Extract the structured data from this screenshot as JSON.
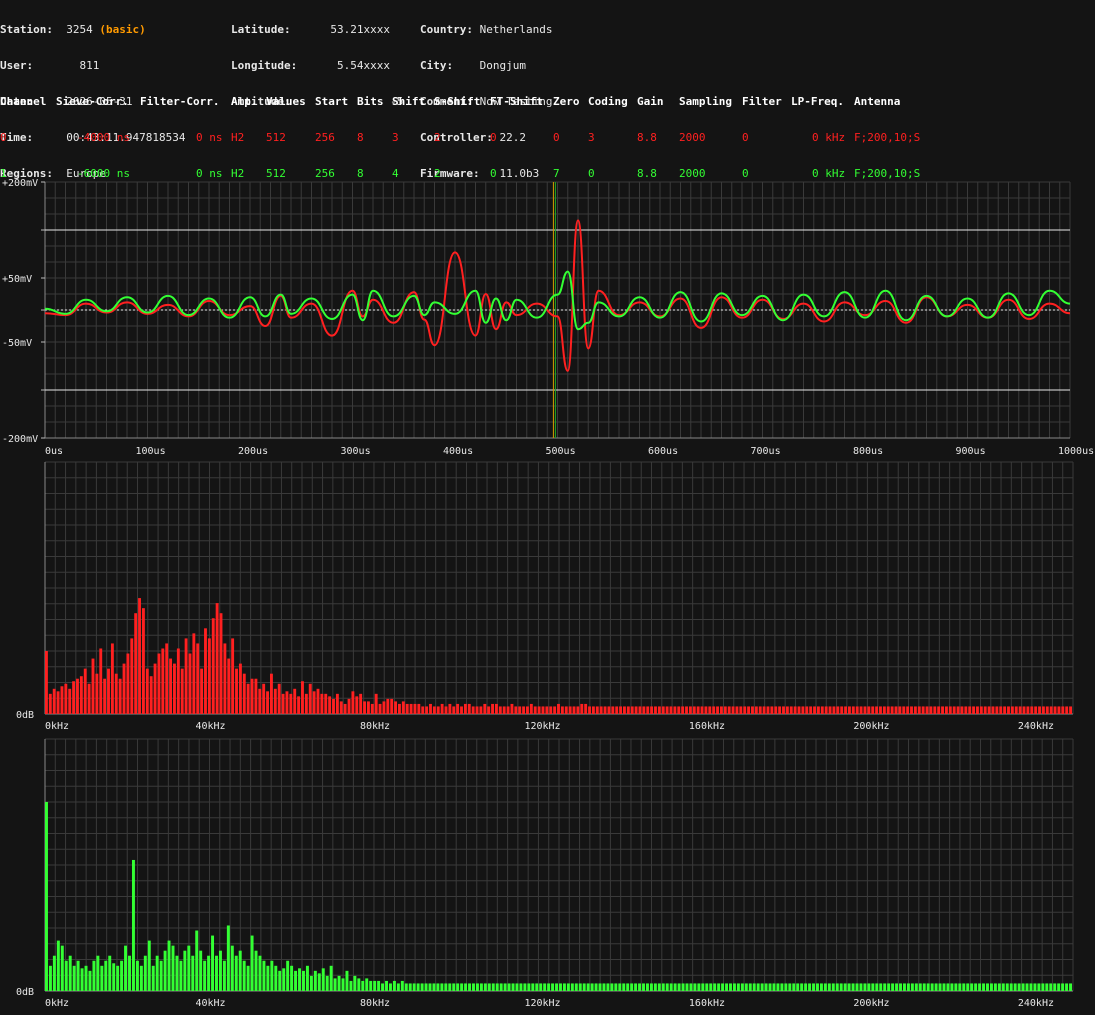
{
  "header": {
    "station_label": "Station:",
    "station_value": "3254",
    "station_tag": "(basic)",
    "user_label": "User:",
    "user_value": "811",
    "date_label": "Date:",
    "date_value": "2026-05-31",
    "time_label": "Time:",
    "time_value": "00:43:11.947818534",
    "regions_label": "Regions:",
    "regions_value": "Europe",
    "latitude_label": "Latitude:",
    "latitude_value": "53.21xxxx",
    "longitude_label": "Longitude:",
    "longitude_value": "5.54xxxx",
    "altitude_label": "Altitude:",
    "altitude_value": "-5",
    "country_label": "Country:",
    "country_value": "Netherlands",
    "city_label": "City:",
    "city_value": "Dongjum",
    "comment_label": "Comment:",
    "comment_value": "Now Testing",
    "controller_label": "Controller:",
    "controller_value": "22.2",
    "firmware_label": "Firmware:",
    "firmware_value": "11.0b3"
  },
  "channels": {
    "headers": [
      "Channel",
      "Sieve-Corr.",
      "Filter-Corr.",
      "Amp.",
      "Values",
      "Start",
      "Bits",
      "Shift",
      "S-Shift",
      "FT-Shift",
      "Zero",
      "Coding",
      "Gain",
      "Sampling",
      "Filter",
      "LP-Freq.",
      "Antenna"
    ],
    "rows": [
      {
        "color": "#ff2020",
        "cells": [
          "0",
          "-4000 ns",
          "0 ns",
          "H2",
          "512",
          "256",
          "8",
          "3",
          "2",
          "0",
          "0",
          "3",
          "8.8",
          "2000",
          "0",
          "0 kHz",
          "F;200,10;S"
        ]
      },
      {
        "color": "#33ff33",
        "cells": [
          "1",
          "-6000 ns",
          "0 ns",
          "H2",
          "512",
          "256",
          "8",
          "4",
          "2",
          "0",
          "7",
          "0",
          "8.8",
          "2000",
          "0",
          "0 kHz",
          "F;200,10;S"
        ]
      }
    ]
  },
  "colors": {
    "ch0": "#ff2020",
    "ch1": "#33ff33",
    "grid": "#3a3a3a",
    "background": "#141414",
    "trigger": "#ff9a00"
  },
  "chart_data": [
    {
      "type": "line",
      "y_unit": "mV",
      "x_unit": "us",
      "xlim": [
        0,
        1000
      ],
      "ylim": [
        -200,
        200
      ],
      "y_tick_labels": [
        "+200mV",
        "+50mV",
        "-50mV",
        "-200mV"
      ],
      "y_tick_values": [
        200,
        50,
        -50,
        -200
      ],
      "x_tick_labels": [
        "0us",
        "100us",
        "200us",
        "300us",
        "400us",
        "500us",
        "600us",
        "700us",
        "800us",
        "900us",
        "1000us"
      ],
      "reference_lines_mV": [
        125,
        -125,
        0
      ],
      "trigger_us": 496,
      "series": [
        {
          "color": "#ff2020",
          "x": [
            0,
            20,
            40,
            60,
            80,
            100,
            120,
            140,
            160,
            180,
            200,
            215,
            230,
            240,
            260,
            280,
            300,
            310,
            320,
            340,
            360,
            370,
            380,
            400,
            420,
            430,
            440,
            450,
            460,
            480,
            500,
            510,
            520,
            530,
            540,
            560,
            580,
            600,
            620,
            640,
            660,
            680,
            700,
            720,
            740,
            760,
            780,
            800,
            820,
            840,
            860,
            880,
            900,
            920,
            940,
            960,
            980,
            1000
          ],
          "y": [
            -5,
            -8,
            10,
            -4,
            12,
            -6,
            8,
            -10,
            14,
            -8,
            6,
            -25,
            22,
            -12,
            10,
            -40,
            30,
            -10,
            16,
            -20,
            28,
            -15,
            -55,
            90,
            -40,
            25,
            -30,
            12,
            -8,
            10,
            -10,
            -95,
            140,
            -60,
            30,
            -8,
            12,
            -10,
            18,
            -28,
            20,
            -12,
            16,
            -14,
            10,
            -18,
            12,
            -8,
            14,
            -20,
            20,
            -10,
            8,
            -12,
            16,
            -14,
            10,
            -5
          ]
        },
        {
          "color": "#33ff33",
          "x": [
            0,
            20,
            40,
            60,
            80,
            100,
            120,
            140,
            160,
            180,
            200,
            215,
            230,
            240,
            260,
            280,
            300,
            310,
            320,
            340,
            360,
            370,
            380,
            400,
            420,
            430,
            440,
            450,
            460,
            480,
            500,
            510,
            520,
            530,
            540,
            560,
            580,
            600,
            620,
            640,
            660,
            680,
            700,
            720,
            740,
            760,
            780,
            800,
            820,
            840,
            860,
            880,
            900,
            920,
            940,
            960,
            980,
            1000
          ],
          "y": [
            2,
            -6,
            16,
            -2,
            20,
            -4,
            22,
            -8,
            18,
            -12,
            20,
            -10,
            24,
            -6,
            18,
            -14,
            24,
            -16,
            30,
            -10,
            22,
            -8,
            12,
            -6,
            30,
            -20,
            18,
            -16,
            16,
            -12,
            24,
            60,
            -30,
            -20,
            12,
            -10,
            20,
            -12,
            28,
            -18,
            26,
            -8,
            22,
            -16,
            24,
            -10,
            28,
            -12,
            30,
            -16,
            22,
            -10,
            18,
            -12,
            26,
            -8,
            30,
            10
          ]
        }
      ]
    },
    {
      "type": "bar",
      "y_unit": "dB",
      "x_unit": "kHz",
      "xlim": [
        0,
        250
      ],
      "y_tick_labels": [
        "0dB"
      ],
      "x_tick_labels": [
        "0kHz",
        "40kHz",
        "80kHz",
        "120kHz",
        "160kHz",
        "200kHz",
        "240kHz"
      ],
      "series": [
        {
          "color": "#ff2020",
          "values": [
            25,
            8,
            10,
            9,
            11,
            12,
            10,
            13,
            14,
            15,
            18,
            12,
            22,
            16,
            26,
            14,
            18,
            28,
            16,
            14,
            20,
            24,
            30,
            40,
            46,
            42,
            18,
            15,
            20,
            24,
            26,
            28,
            22,
            20,
            26,
            18,
            30,
            24,
            32,
            28,
            18,
            34,
            30,
            38,
            44,
            40,
            28,
            22,
            30,
            18,
            20,
            16,
            12,
            14,
            14,
            10,
            12,
            9,
            16,
            10,
            12,
            8,
            9,
            8,
            10,
            7,
            13,
            8,
            12,
            9,
            10,
            8,
            8,
            7,
            6,
            8,
            5,
            4,
            6,
            9,
            7,
            8,
            5,
            5,
            4,
            8,
            4,
            5,
            6,
            6,
            5,
            4,
            5,
            4,
            4,
            4,
            4,
            3,
            3,
            4,
            3,
            3,
            4,
            3,
            4,
            3,
            4,
            3,
            4,
            4,
            3,
            3,
            3,
            4,
            3,
            4,
            4,
            3,
            3,
            3,
            4,
            3,
            3,
            3,
            3,
            4,
            3,
            3,
            3,
            3,
            3,
            3,
            4,
            3,
            3,
            3,
            3,
            3,
            4,
            4,
            3,
            3,
            3,
            3,
            3,
            3,
            3,
            3,
            3,
            3,
            3,
            3,
            3,
            3,
            3,
            3,
            3,
            3,
            3,
            3,
            3,
            3,
            3,
            3,
            3,
            3,
            3,
            3,
            3,
            3,
            3,
            3,
            3,
            3,
            3,
            3,
            3,
            3,
            3,
            3,
            3,
            3,
            3,
            3,
            3,
            3,
            3,
            3,
            3,
            3,
            3,
            3,
            3,
            3,
            3,
            3,
            3,
            3,
            3,
            3,
            3,
            3,
            3,
            3,
            3,
            3,
            3,
            3,
            3,
            3,
            3,
            3,
            3,
            3,
            3,
            3,
            3,
            3,
            3,
            3,
            3,
            3,
            3,
            3,
            3,
            3,
            3,
            3,
            3,
            3,
            3,
            3,
            3,
            3,
            3,
            3,
            3,
            3,
            3,
            3,
            3,
            3,
            3,
            3,
            3,
            3,
            3,
            3,
            3,
            3,
            3,
            3,
            3,
            3,
            3,
            3,
            3,
            3,
            3,
            3,
            3,
            3,
            3,
            3,
            3
          ]
        }
      ]
    },
    {
      "type": "bar",
      "y_unit": "dB",
      "x_unit": "kHz",
      "xlim": [
        0,
        250
      ],
      "y_tick_labels": [
        "0dB"
      ],
      "x_tick_labels": [
        "0kHz",
        "40kHz",
        "80kHz",
        "120kHz",
        "160kHz",
        "200kHz",
        "240kHz"
      ],
      "series": [
        {
          "color": "#33ff33",
          "values": [
            75,
            10,
            14,
            20,
            18,
            12,
            14,
            10,
            12,
            9,
            10,
            8,
            12,
            14,
            10,
            12,
            14,
            11,
            10,
            12,
            18,
            14,
            52,
            12,
            10,
            14,
            20,
            10,
            14,
            12,
            16,
            20,
            18,
            14,
            12,
            16,
            18,
            14,
            24,
            16,
            12,
            14,
            22,
            14,
            16,
            12,
            26,
            18,
            14,
            16,
            12,
            10,
            22,
            16,
            14,
            12,
            10,
            12,
            10,
            8,
            9,
            12,
            10,
            8,
            9,
            8,
            10,
            6,
            8,
            7,
            9,
            6,
            10,
            5,
            6,
            5,
            8,
            4,
            6,
            5,
            4,
            5,
            4,
            4,
            4,
            3,
            4,
            3,
            4,
            3,
            4,
            3,
            3,
            3,
            3,
            3,
            3,
            3,
            3,
            3,
            3,
            3,
            3,
            3,
            3,
            3,
            3,
            3,
            3,
            3,
            3,
            3,
            3,
            3,
            3,
            3,
            3,
            3,
            3,
            3,
            3,
            3,
            3,
            3,
            3,
            3,
            3,
            3,
            3,
            3,
            3,
            3,
            3,
            3,
            3,
            3,
            3,
            3,
            3,
            3,
            3,
            3,
            3,
            3,
            3,
            3,
            3,
            3,
            3,
            3,
            3,
            3,
            3,
            3,
            3,
            3,
            3,
            3,
            3,
            3,
            3,
            3,
            3,
            3,
            3,
            3,
            3,
            3,
            3,
            3,
            3,
            3,
            3,
            3,
            3,
            3,
            3,
            3,
            3,
            3,
            3,
            3,
            3,
            3,
            3,
            3,
            3,
            3,
            3,
            3,
            3,
            3,
            3,
            3,
            3,
            3,
            3,
            3,
            3,
            3,
            3,
            3,
            3,
            3,
            3,
            3,
            3,
            3,
            3,
            3,
            3,
            3,
            3,
            3,
            3,
            3,
            3,
            3,
            3,
            3,
            3,
            3,
            3,
            3,
            3,
            3,
            3,
            3,
            3,
            3,
            3,
            3,
            3,
            3,
            3,
            3,
            3,
            3,
            3,
            3,
            3,
            3,
            3,
            3,
            3,
            3,
            3,
            3,
            3,
            3,
            3,
            3,
            3,
            3,
            3,
            3,
            3,
            3,
            3,
            3
          ]
        }
      ]
    }
  ]
}
